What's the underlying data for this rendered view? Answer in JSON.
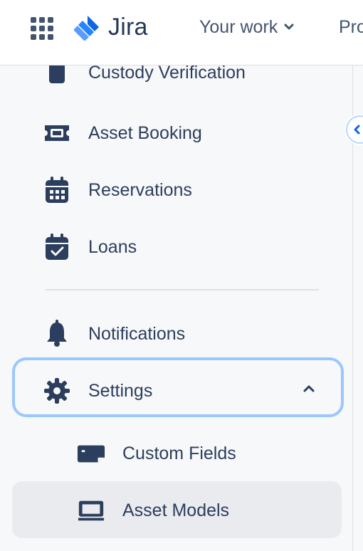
{
  "topbar": {
    "logo_text": "Jira",
    "your_work_label": "Your work",
    "projects_label": "Pro"
  },
  "sidebar": {
    "cut_item_label": "Custody Verification",
    "items": [
      {
        "label": "Asset Booking",
        "icon": "ticket-icon"
      },
      {
        "label": "Reservations",
        "icon": "calendar-grid-icon"
      },
      {
        "label": "Loans",
        "icon": "calendar-check-icon"
      },
      {
        "label": "Notifications",
        "icon": "bell-icon"
      },
      {
        "label": "Settings",
        "icon": "gear-icon"
      },
      {
        "label": "Custom Fields",
        "icon": "card-icon"
      },
      {
        "label": "Asset Models",
        "icon": "monitor-icon"
      }
    ]
  },
  "colors": {
    "sidebar_text": "#2c3e5d",
    "nav_text": "#44546f",
    "brand_blue": "#0c66e4",
    "focus_outline": "#9bc7ff",
    "selected_background": "#e9ebee"
  }
}
